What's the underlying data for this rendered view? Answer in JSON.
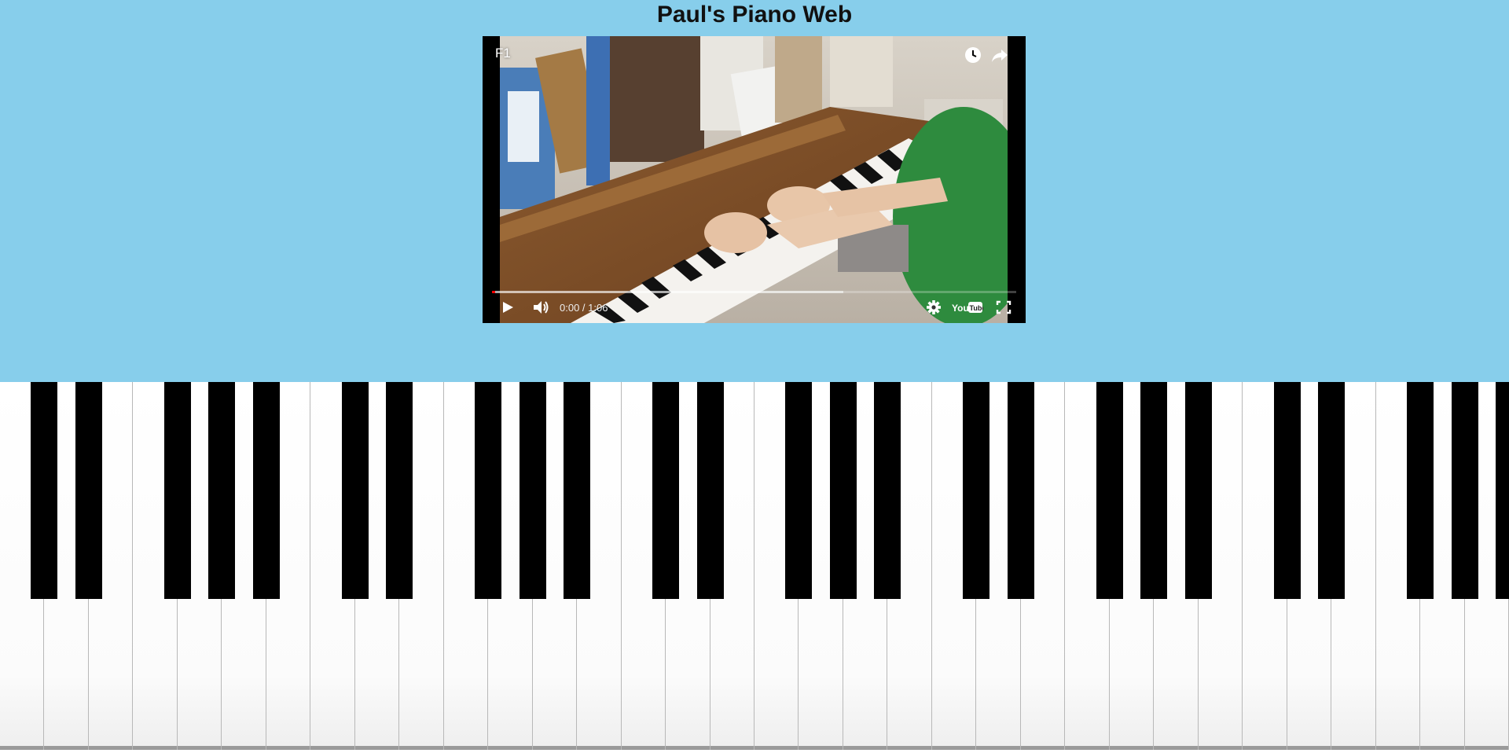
{
  "page": {
    "title": "Paul's Piano Web",
    "background": "#87ceeb"
  },
  "video": {
    "title": "F1",
    "time": "0:00 / 1:06",
    "progress_buffered": 0.67,
    "progress_played": 0.0,
    "icons": {
      "watch_later": "clock-icon",
      "share": "share-icon",
      "play": "play-icon",
      "volume": "volume-icon",
      "settings": "gear-icon",
      "youtube": "youtube-logo-icon",
      "fullscreen": "fullscreen-icon"
    },
    "youtube_logo_text": "YouTube"
  },
  "keyboard": {
    "white_key_color": "#ffffff",
    "black_key_color": "#000000"
  }
}
